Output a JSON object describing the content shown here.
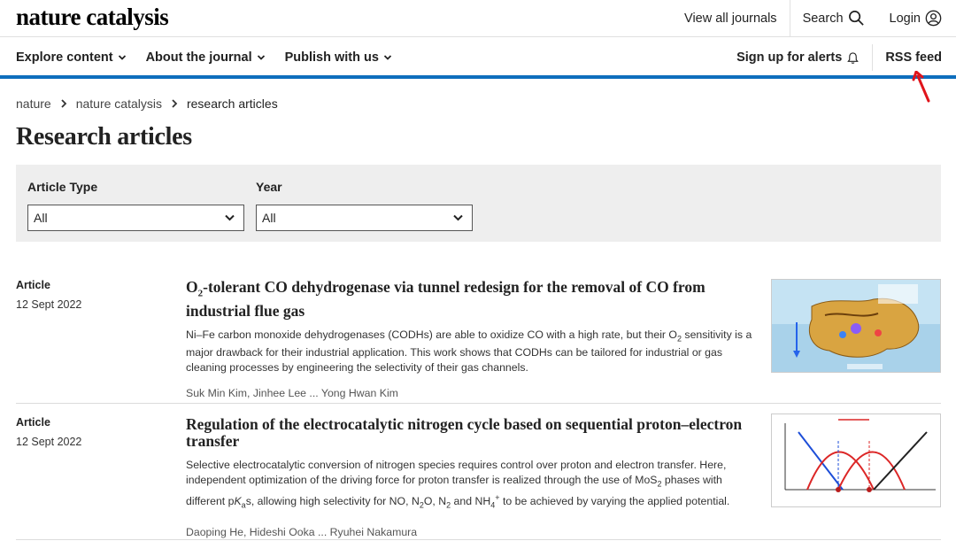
{
  "header": {
    "logo": "nature catalysis",
    "view_all_journals": "View all journals",
    "search": "Search",
    "login": "Login"
  },
  "nav": {
    "explore": "Explore content",
    "about": "About the journal",
    "publish": "Publish with us",
    "alerts": "Sign up for alerts",
    "rss": "RSS feed"
  },
  "breadcrumb": [
    "nature",
    "nature catalysis",
    "research articles"
  ],
  "page_title": "Research articles",
  "filters": {
    "article_type_label": "Article Type",
    "article_type_value": "All",
    "year_label": "Year",
    "year_value": "All"
  },
  "articles": [
    {
      "type": "Article",
      "date": "12 Sept 2022",
      "title_pre": "O",
      "title_sub": "2",
      "title_post": "-tolerant CO dehydrogenase via tunnel redesign for the removal of CO from industrial flue gas",
      "desc_1": "Ni–Fe carbon monoxide dehydrogenases (CODHs) are able to oxidize CO with a high rate, but their O",
      "desc_sub": "2",
      "desc_2": " sensitivity is a major drawback for their industrial application. This work shows that CODHs can be tailored for industrial or gas cleaning processes by engineering the selectivity of their gas channels.",
      "authors": "Suk Min Kim, Jinhee Lee ... Yong Hwan Kim"
    },
    {
      "type": "Article",
      "date": "12 Sept 2022",
      "title": "Regulation of the electrocatalytic nitrogen cycle based on sequential proton–electron transfer",
      "desc_a": "Selective electrocatalytic conversion of nitrogen species requires control over proton and electron transfer. Here, independent optimization of the driving force for proton transfer is realized through the use of MoS",
      "desc_b": "2",
      "desc_c": " phases with different p",
      "desc_d": "K",
      "desc_e": "a",
      "desc_f": "s, allowing high selectivity for NO, N",
      "desc_g": "2",
      "desc_h": "O, N",
      "desc_i": "2",
      "desc_j": " and NH",
      "desc_k": "4",
      "desc_l": "+",
      "desc_m": " to be achieved by varying the applied potential.",
      "authors": "Daoping He, Hideshi Ooka ... Ryuhei Nakamura"
    }
  ]
}
